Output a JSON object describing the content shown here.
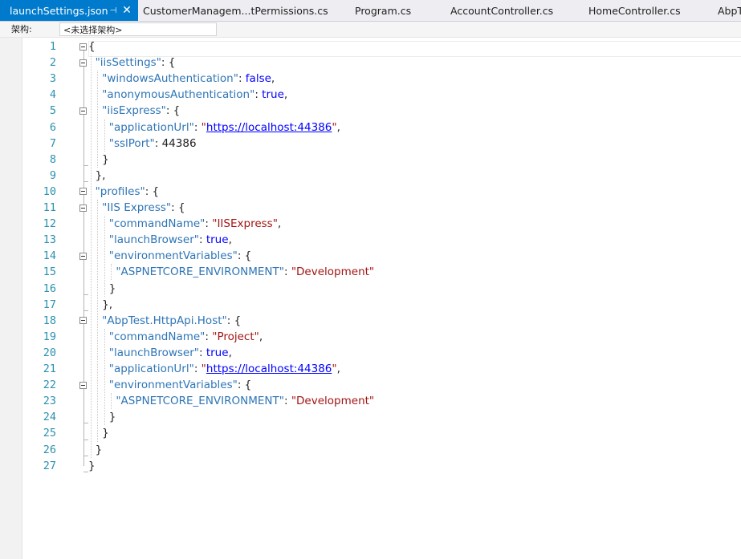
{
  "tabs": [
    {
      "label": "launchSettings.json",
      "active": true
    },
    {
      "label": "CustomerManagem...tPermissions.cs"
    },
    {
      "label": "Program.cs"
    },
    {
      "label": "AccountController.cs"
    },
    {
      "label": "HomeController.cs"
    },
    {
      "label": "AbpT"
    }
  ],
  "tab_icons": {
    "pin": "pin-icon",
    "close": "close-icon"
  },
  "navbar": {
    "label": "架构:",
    "selected": "<未选择架构>"
  },
  "line_numbers": [
    "1",
    "2",
    "3",
    "4",
    "5",
    "6",
    "7",
    "8",
    "9",
    "10",
    "11",
    "12",
    "13",
    "14",
    "15",
    "16",
    "17",
    "18",
    "19",
    "20",
    "21",
    "22",
    "23",
    "24",
    "25",
    "26",
    "27"
  ],
  "code_lines": [
    [
      {
        "t": "{",
        "c": "p"
      }
    ],
    [
      {
        "t": "  ",
        "c": "p"
      },
      {
        "t": "\"iisSettings\"",
        "c": "k"
      },
      {
        "t": ": {",
        "c": "p"
      }
    ],
    [
      {
        "t": "    ",
        "c": "p"
      },
      {
        "t": "\"windowsAuthentication\"",
        "c": "k"
      },
      {
        "t": ": ",
        "c": "p"
      },
      {
        "t": "false",
        "c": "b"
      },
      {
        "t": ",",
        "c": "p"
      }
    ],
    [
      {
        "t": "    ",
        "c": "p"
      },
      {
        "t": "\"anonymousAuthentication\"",
        "c": "k"
      },
      {
        "t": ": ",
        "c": "p"
      },
      {
        "t": "true",
        "c": "b"
      },
      {
        "t": ",",
        "c": "p"
      }
    ],
    [
      {
        "t": "    ",
        "c": "p"
      },
      {
        "t": "\"iisExpress\"",
        "c": "k"
      },
      {
        "t": ": {",
        "c": "p"
      }
    ],
    [
      {
        "t": "      ",
        "c": "p"
      },
      {
        "t": "\"applicationUrl\"",
        "c": "k"
      },
      {
        "t": ": ",
        "c": "p"
      },
      {
        "t": "\"",
        "c": "s"
      },
      {
        "t": "https://localhost:44386",
        "c": "u"
      },
      {
        "t": "\"",
        "c": "s"
      },
      {
        "t": ",",
        "c": "p"
      }
    ],
    [
      {
        "t": "      ",
        "c": "p"
      },
      {
        "t": "\"sslPort\"",
        "c": "k"
      },
      {
        "t": ": 44386",
        "c": "p"
      }
    ],
    [
      {
        "t": "    }",
        "c": "p"
      }
    ],
    [
      {
        "t": "  },",
        "c": "p"
      }
    ],
    [
      {
        "t": "  ",
        "c": "p"
      },
      {
        "t": "\"profiles\"",
        "c": "k"
      },
      {
        "t": ": {",
        "c": "p"
      }
    ],
    [
      {
        "t": "    ",
        "c": "p"
      },
      {
        "t": "\"IIS Express\"",
        "c": "k"
      },
      {
        "t": ": {",
        "c": "p"
      }
    ],
    [
      {
        "t": "      ",
        "c": "p"
      },
      {
        "t": "\"commandName\"",
        "c": "k"
      },
      {
        "t": ": ",
        "c": "p"
      },
      {
        "t": "\"IISExpress\"",
        "c": "s"
      },
      {
        "t": ",",
        "c": "p"
      }
    ],
    [
      {
        "t": "      ",
        "c": "p"
      },
      {
        "t": "\"launchBrowser\"",
        "c": "k"
      },
      {
        "t": ": ",
        "c": "p"
      },
      {
        "t": "true",
        "c": "b"
      },
      {
        "t": ",",
        "c": "p"
      }
    ],
    [
      {
        "t": "      ",
        "c": "p"
      },
      {
        "t": "\"environmentVariables\"",
        "c": "k"
      },
      {
        "t": ": {",
        "c": "p"
      }
    ],
    [
      {
        "t": "        ",
        "c": "p"
      },
      {
        "t": "\"ASPNETCORE_ENVIRONMENT\"",
        "c": "k"
      },
      {
        "t": ": ",
        "c": "p"
      },
      {
        "t": "\"Development\"",
        "c": "s"
      }
    ],
    [
      {
        "t": "      }",
        "c": "p"
      }
    ],
    [
      {
        "t": "    },",
        "c": "p"
      }
    ],
    [
      {
        "t": "    ",
        "c": "p"
      },
      {
        "t": "\"AbpTest.HttpApi.Host\"",
        "c": "k"
      },
      {
        "t": ": {",
        "c": "p"
      }
    ],
    [
      {
        "t": "      ",
        "c": "p"
      },
      {
        "t": "\"commandName\"",
        "c": "k"
      },
      {
        "t": ": ",
        "c": "p"
      },
      {
        "t": "\"Project\"",
        "c": "s"
      },
      {
        "t": ",",
        "c": "p"
      }
    ],
    [
      {
        "t": "      ",
        "c": "p"
      },
      {
        "t": "\"launchBrowser\"",
        "c": "k"
      },
      {
        "t": ": ",
        "c": "p"
      },
      {
        "t": "true",
        "c": "b"
      },
      {
        "t": ",",
        "c": "p"
      }
    ],
    [
      {
        "t": "      ",
        "c": "p"
      },
      {
        "t": "\"applicationUrl\"",
        "c": "k"
      },
      {
        "t": ": ",
        "c": "p"
      },
      {
        "t": "\"",
        "c": "s"
      },
      {
        "t": "https://localhost:44386",
        "c": "u"
      },
      {
        "t": "\"",
        "c": "s"
      },
      {
        "t": ",",
        "c": "p"
      }
    ],
    [
      {
        "t": "      ",
        "c": "p"
      },
      {
        "t": "\"environmentVariables\"",
        "c": "k"
      },
      {
        "t": ": {",
        "c": "p"
      }
    ],
    [
      {
        "t": "        ",
        "c": "p"
      },
      {
        "t": "\"ASPNETCORE_ENVIRONMENT\"",
        "c": "k"
      },
      {
        "t": ": ",
        "c": "p"
      },
      {
        "t": "\"Development\"",
        "c": "s"
      }
    ],
    [
      {
        "t": "      }",
        "c": "p"
      }
    ],
    [
      {
        "t": "    }",
        "c": "p"
      }
    ],
    [
      {
        "t": "  }",
        "c": "p"
      }
    ],
    [
      {
        "t": "}",
        "c": "p"
      }
    ]
  ],
  "colors": {
    "accent": "#007acc",
    "key": "#2e75b6",
    "string": "#a31515",
    "keyword": "#0000ff",
    "line_number": "#2b91af"
  }
}
